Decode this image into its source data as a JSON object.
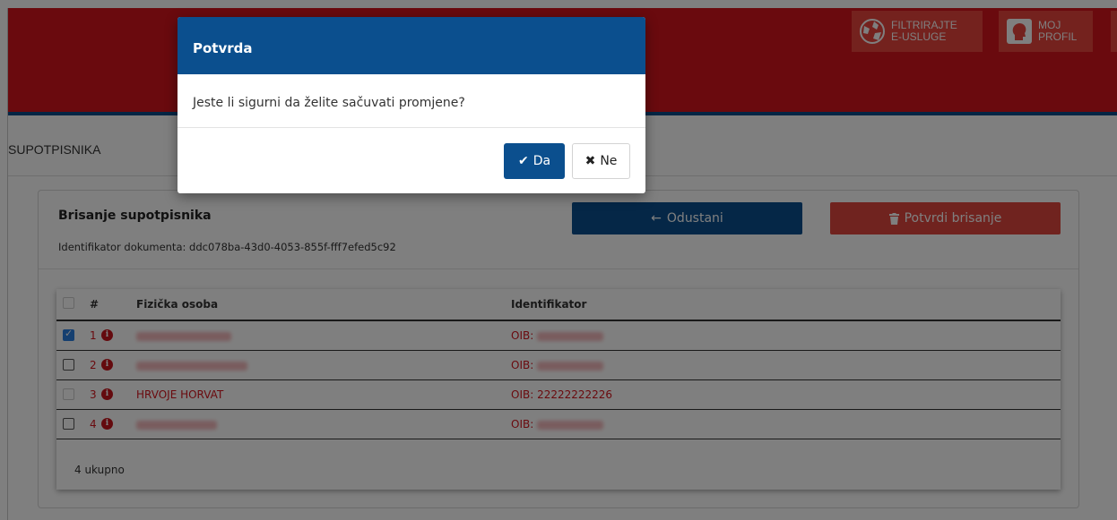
{
  "topbar": {
    "filter_label_1": "FILTRIRAJTE",
    "filter_label_2": "E-USLUGE",
    "profile_label_1": "MOJ",
    "profile_label_2": "PROFIL"
  },
  "breadcrumb": {
    "label": "SUPOTPISNIKA"
  },
  "panel": {
    "title": "Brisanje supotpisnika",
    "doc_label": "Identifikator dokumenta: ddc078ba-43d0-4053-855f-fff7efed5c92",
    "cancel_label": "Odustani",
    "confirm_label": "Potvrdi brisanje"
  },
  "table": {
    "headers": {
      "num": "#",
      "person": "Fizička osoba",
      "identifier": "Identifikator"
    },
    "rows": [
      {
        "num": "1",
        "name": "",
        "oib": "OIB:",
        "checked": true,
        "disabled": false
      },
      {
        "num": "2",
        "name": "",
        "oib": "OIB:",
        "checked": false,
        "disabled": false
      },
      {
        "num": "3",
        "name": "HRVOJE HORVAT",
        "oib": "OIB: 22222222226",
        "checked": false,
        "disabled": true
      },
      {
        "num": "4",
        "name": "",
        "oib": "OIB:",
        "checked": false,
        "disabled": false
      }
    ],
    "total": "4 ukupno"
  },
  "modal": {
    "title": "Potvrda",
    "message": "Jeste li sigurni da želite sačuvati promjene?",
    "yes_label": "Da",
    "no_label": "Ne"
  },
  "colors": {
    "primary": "#0b4f8e",
    "danger": "#d4141d"
  }
}
